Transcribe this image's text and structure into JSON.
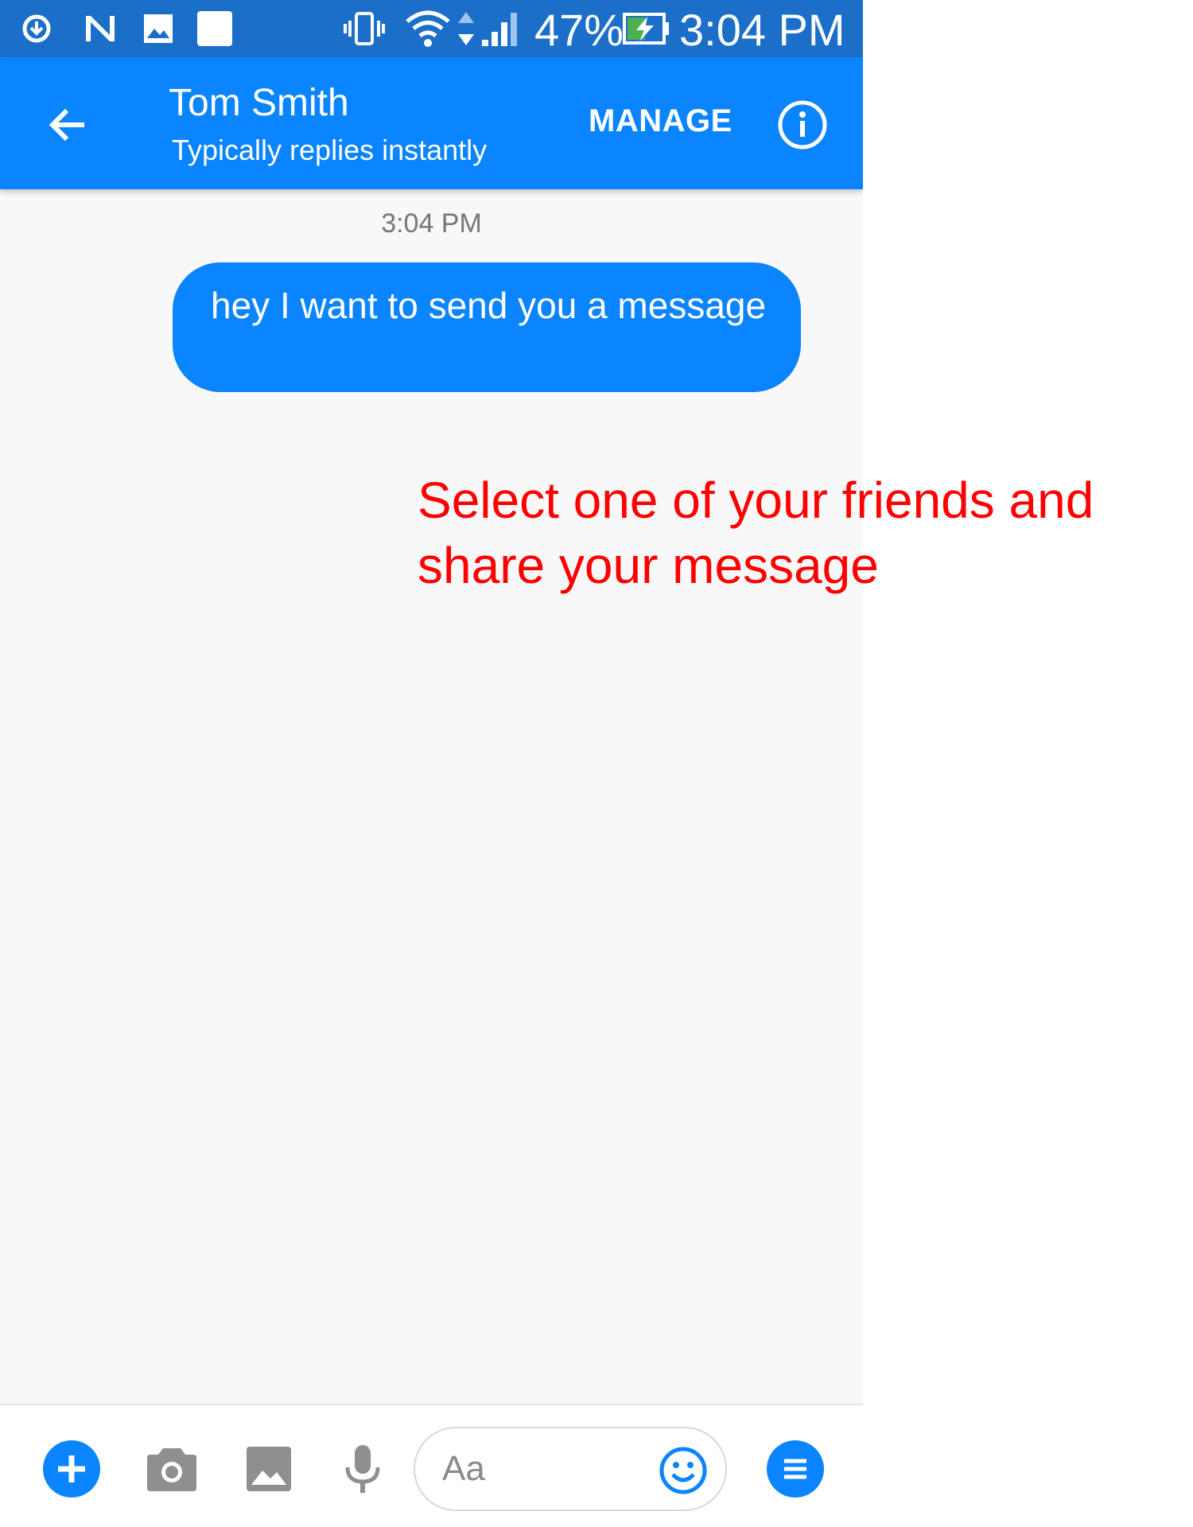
{
  "status_bar": {
    "battery": "47%",
    "time": "3:04 PM",
    "icons": [
      "download-icon",
      "nfc-n-icon",
      "image-icon",
      "square-icon",
      "vibrate-icon",
      "wifi-icon",
      "data-arrows-icon",
      "signal-icon",
      "battery-charging-icon"
    ]
  },
  "header": {
    "contact_name": "Tom Smith",
    "contact_status": "Typically replies instantly",
    "manage_label": "MANAGE",
    "back_icon": "arrow-left-icon",
    "info_icon": "info-icon"
  },
  "conversation": {
    "timestamp": "3:04 PM",
    "messages": [
      {
        "text": "hey I want to send you a message",
        "from": "me"
      }
    ]
  },
  "annotation": {
    "text": "Select one of your friends and share your message",
    "color": "#ff0000"
  },
  "composer": {
    "placeholder": "Aa",
    "buttons": [
      "plus-icon",
      "camera-icon",
      "gallery-icon",
      "microphone-icon",
      "emoji-icon",
      "menu-icon"
    ]
  },
  "colors": {
    "accent": "#0a84ff",
    "status_bar": "#1b6fc9",
    "background": "#f8f8f8"
  }
}
